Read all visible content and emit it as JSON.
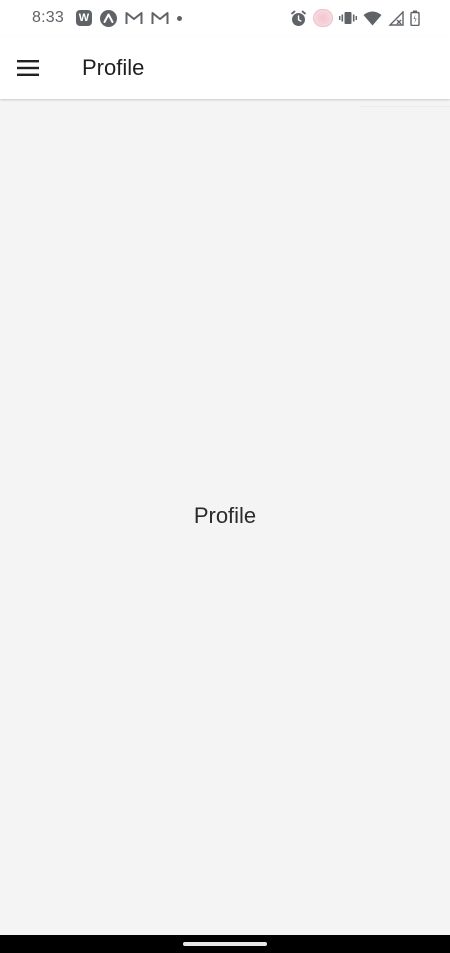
{
  "status_bar": {
    "time": "8:33",
    "left_icons": [
      "w-badge-icon",
      "arc-app-icon",
      "gmail-icon",
      "gmail-icon",
      "notification-dot-icon"
    ],
    "w_badge_text": "W",
    "right_icons": [
      "alarm-icon",
      "brain-app-icon",
      "vibrate-icon",
      "wifi-icon",
      "cell-signal-icon",
      "battery-icon"
    ]
  },
  "app_bar": {
    "title": "Profile",
    "menu_icon": "hamburger-menu-icon"
  },
  "content": {
    "label": "Profile"
  },
  "colors": {
    "background": "#f4f4f4",
    "app_bar": "#ffffff",
    "status_icon": "#5f6368",
    "nav_bar": "#000000"
  }
}
